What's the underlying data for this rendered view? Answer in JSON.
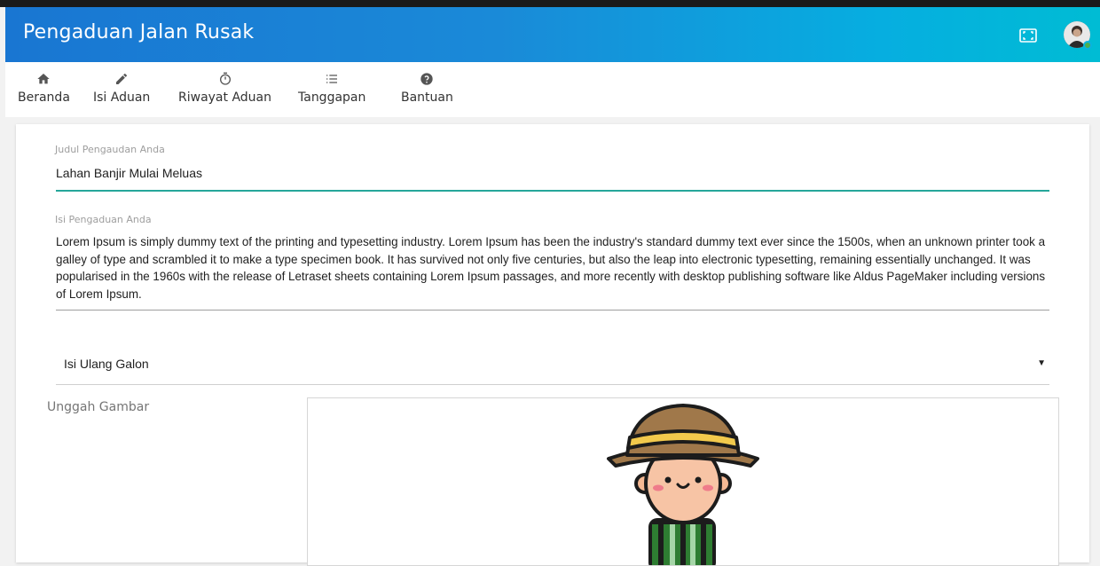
{
  "app": {
    "title": "Pengaduan Jalan Rusak"
  },
  "nav": {
    "items": [
      {
        "label": "Beranda",
        "icon": "home-icon"
      },
      {
        "label": "Isi Aduan",
        "icon": "pencil-icon"
      },
      {
        "label": "Riwayat Aduan",
        "icon": "timer-icon"
      },
      {
        "label": "Tanggapan",
        "icon": "list-icon"
      },
      {
        "label": "Bantuan",
        "icon": "help-icon"
      }
    ]
  },
  "form": {
    "judul_label": "Judul Pengaudan Anda",
    "judul_value": "Lahan Banjir Mulai Meluas",
    "isi_label": "Isi Pengaduan Anda",
    "isi_value": "Lorem Ipsum is simply dummy text of the printing and typesetting industry. Lorem Ipsum has been the industry's standard dummy text ever since the 1500s, when an unknown printer took a galley of type and scrambled it to make a type specimen book. It has survived not only five centuries, but also the leap into electronic typesetting, remaining essentially unchanged. It was popularised in the 1960s with the release of Letraset sheets containing Lorem Ipsum passages, and more recently with desktop publishing software like Aldus PageMaker including versions of Lorem Ipsum.",
    "kategori_value": "Isi Ulang Galon",
    "upload_label": "Unggah Gambar"
  },
  "colors": {
    "appbar_start": "#1976d2",
    "appbar_end": "#00bcd4",
    "active_underline": "#26a69a",
    "online_dot": "#4caf50"
  }
}
